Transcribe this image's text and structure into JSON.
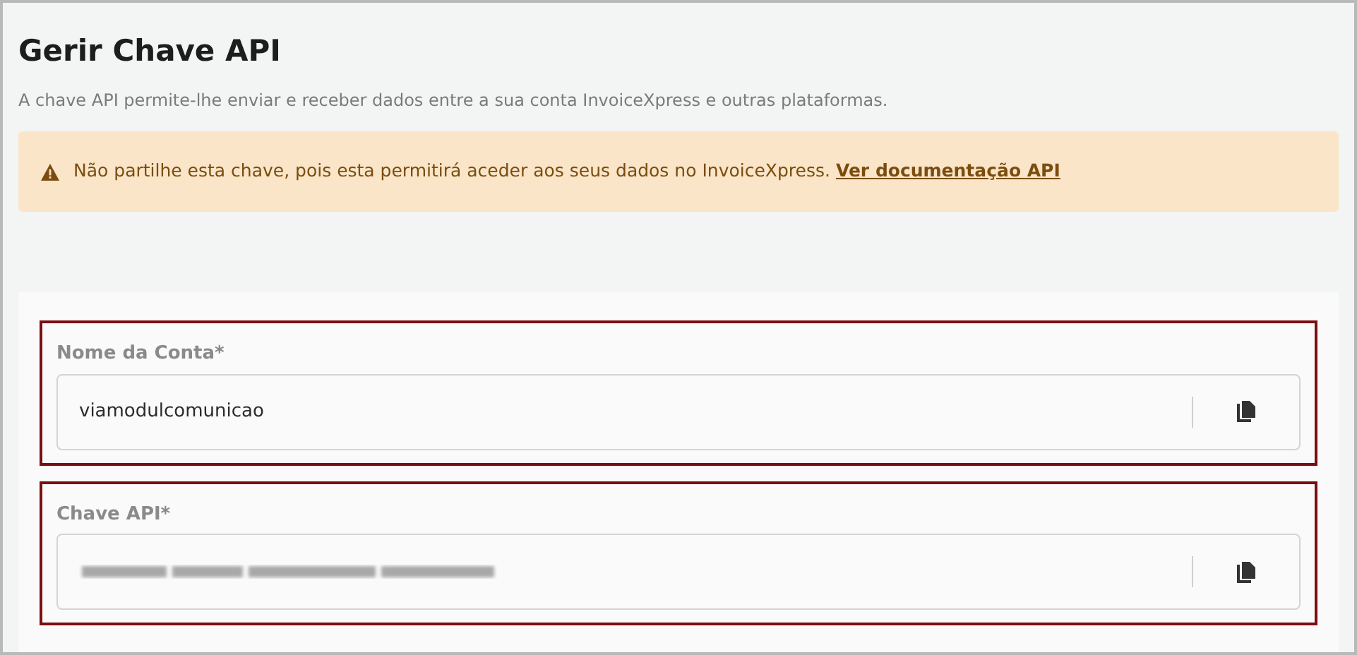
{
  "title": "Gerir Chave API",
  "description": "A chave API permite-lhe enviar e receber dados entre a sua conta InvoiceXpress e outras plataformas.",
  "alert": {
    "text": "Não partilhe esta chave, pois esta permitirá aceder aos seus dados no InvoiceXpress.",
    "link": "Ver documentação API"
  },
  "fields": [
    {
      "label": "Nome da Conta*",
      "kind": "text",
      "value": "viamodulcomunicao"
    },
    {
      "label": "Chave API*",
      "kind": "blurred"
    }
  ]
}
